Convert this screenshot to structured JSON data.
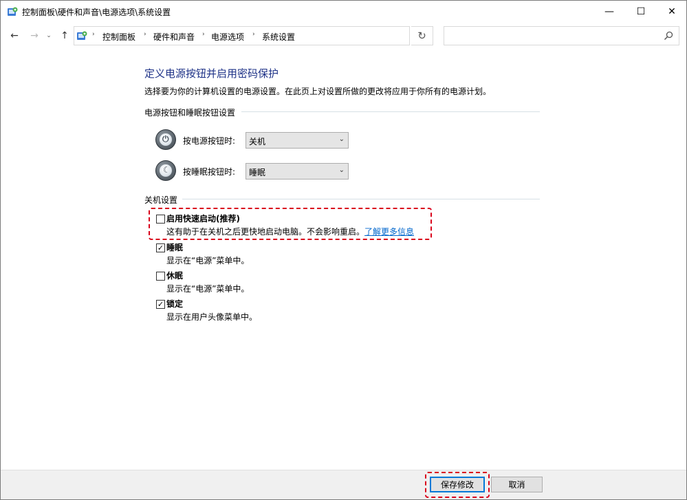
{
  "window": {
    "title": "控制面板\\硬件和声音\\电源选项\\系统设置",
    "minimize_glyph": "—",
    "maximize_glyph": "☐",
    "close_glyph": "✕"
  },
  "nav": {
    "back_glyph": "←",
    "forward_glyph": "→",
    "recent_glyph": "⌄",
    "up_glyph": "↑",
    "breadcrumbs": [
      "控制面板",
      "硬件和声音",
      "电源选项",
      "系统设置"
    ],
    "breadcrumb_sep": "›",
    "dropdown_glyph": "⌄",
    "refresh_glyph": "↻",
    "search_placeholder": ""
  },
  "page": {
    "title": "定义电源按钮并启用密码保护",
    "description": "选择要为你的计算机设置的电源设置。在此页上对设置所做的更改将应用于你所有的电源计划。"
  },
  "power_buttons": {
    "section_title": "电源按钮和睡眠按钮设置",
    "power_button": {
      "label": "按电源按钮时:",
      "value": "关机",
      "icon": "power-icon"
    },
    "sleep_button": {
      "label": "按睡眠按钮时:",
      "value": "睡眠",
      "icon": "sleep-moon-icon"
    }
  },
  "shutdown": {
    "section_title": "关机设置",
    "options": [
      {
        "label": "启用快速启动(推荐)",
        "checked": false,
        "desc": "这有助于在关机之后更快地启动电脑。不会影响重启。",
        "link": "了解更多信息"
      },
      {
        "label": "睡眠",
        "checked": true,
        "desc": "显示在“电源”菜单中。"
      },
      {
        "label": "休眠",
        "checked": false,
        "desc": "显示在“电源”菜单中。"
      },
      {
        "label": "锁定",
        "checked": true,
        "desc": "显示在用户头像菜单中。"
      }
    ]
  },
  "footer": {
    "save_label": "保存修改",
    "cancel_label": "取消"
  },
  "colors": {
    "title_blue": "#1e3287",
    "link_blue": "#0066cc",
    "highlight_red": "#d9001b",
    "primary_border": "#0078d7"
  },
  "checkmark_glyph": "✓"
}
